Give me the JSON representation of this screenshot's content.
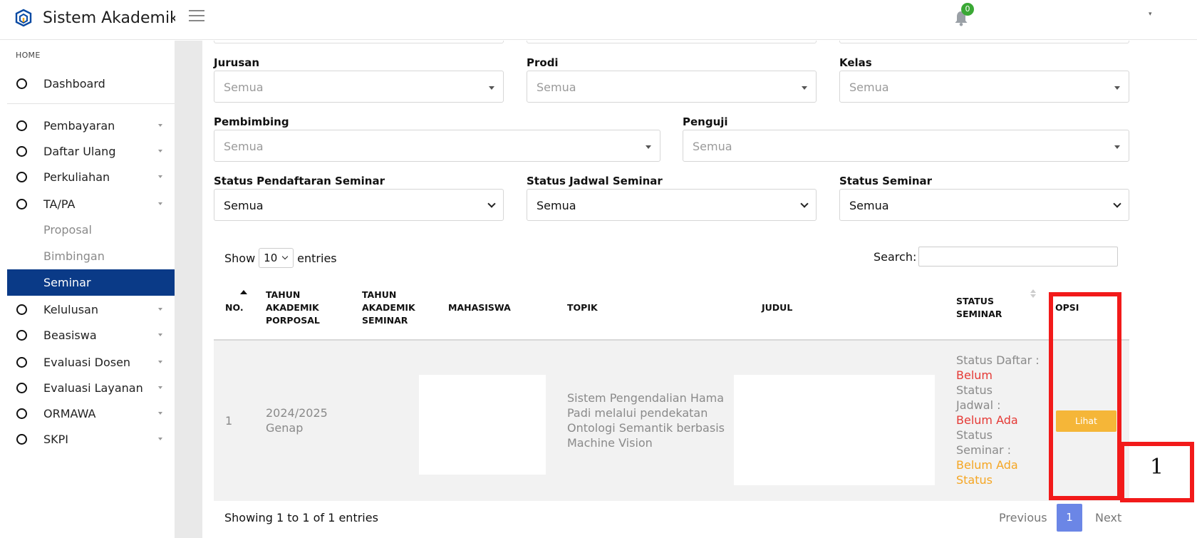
{
  "app": {
    "title": "Sistem Akademik"
  },
  "header": {
    "notification_count": "0",
    "user_caret": "▾"
  },
  "sidebar": {
    "heading": "HOME",
    "items": [
      {
        "label": "Dashboard"
      },
      {
        "label": "Pembayaran"
      },
      {
        "label": "Daftar Ulang"
      },
      {
        "label": "Perkuliahan"
      },
      {
        "label": "TA/PA"
      },
      {
        "label": "Kelulusan"
      },
      {
        "label": "Beasiswa"
      },
      {
        "label": "Evaluasi Dosen"
      },
      {
        "label": "Evaluasi Layanan"
      },
      {
        "label": "ORMAWA"
      },
      {
        "label": "SKPI"
      }
    ],
    "subitems": [
      {
        "label": "Proposal"
      },
      {
        "label": "Bimbingan"
      },
      {
        "label": "Seminar"
      }
    ]
  },
  "filters": {
    "jurusan": {
      "label": "Jurusan",
      "value": "Semua"
    },
    "prodi": {
      "label": "Prodi",
      "value": "Semua"
    },
    "kelas": {
      "label": "Kelas",
      "value": "Semua"
    },
    "pembimbing": {
      "label": "Pembimbing",
      "value": "Semua"
    },
    "penguji": {
      "label": "Penguji",
      "value": "Semua"
    },
    "status_pendaftaran": {
      "label": "Status Pendaftaran Seminar",
      "value": "Semua"
    },
    "status_jadwal": {
      "label": "Status Jadwal Seminar",
      "value": "Semua"
    },
    "status_seminar": {
      "label": "Status Seminar",
      "value": "Semua"
    }
  },
  "table": {
    "show_label": "Show",
    "entries_label": "entries",
    "page_length": "10",
    "search_label": "Search:",
    "columns": {
      "no": "NO.",
      "tahun_proposal": [
        "TAHUN",
        "AKADEMIK",
        "PORPOSAL"
      ],
      "tahun_seminar": [
        "TAHUN",
        "AKADEMIK",
        "SEMINAR"
      ],
      "mahasiswa": "MAHASISWA",
      "topik": "TOPIK",
      "judul": "JUDUL",
      "status": [
        "STATUS",
        "SEMINAR"
      ],
      "opsi": "OPSI"
    },
    "rows": [
      {
        "no": "1",
        "tahun_lines": [
          "2024/2025",
          "Genap"
        ],
        "topik_lines": [
          "Sistem Pengendalian Hama",
          "Padi melalui pendekatan",
          "Ontologi Semantik berbasis",
          "Machine Vision"
        ],
        "status_lines": [
          {
            "text": "Status Daftar :",
            "tone": "label"
          },
          {
            "text": "Belum",
            "tone": "red"
          },
          {
            "text": "Status",
            "tone": "label"
          },
          {
            "text": "Jadwal :",
            "tone": "label"
          },
          {
            "text": "Belum Ada",
            "tone": "red"
          },
          {
            "text": "Status",
            "tone": "label"
          },
          {
            "text": "Seminar :",
            "tone": "label"
          },
          {
            "text": "Belum Ada",
            "tone": "orange"
          },
          {
            "text": "Status",
            "tone": "orange"
          }
        ],
        "action": "Lihat"
      }
    ],
    "info": "Showing 1 to 1 of 1 entries",
    "pagination": {
      "previous": "Previous",
      "current": "1",
      "next": "Next"
    }
  },
  "annotation": {
    "number": "1"
  },
  "colors": {
    "active_nav": "#0a3a87",
    "badge": "#3aa835",
    "lihat": "#f5b638",
    "page_current": "#6b86e6",
    "annotation": "#f21a1a"
  }
}
